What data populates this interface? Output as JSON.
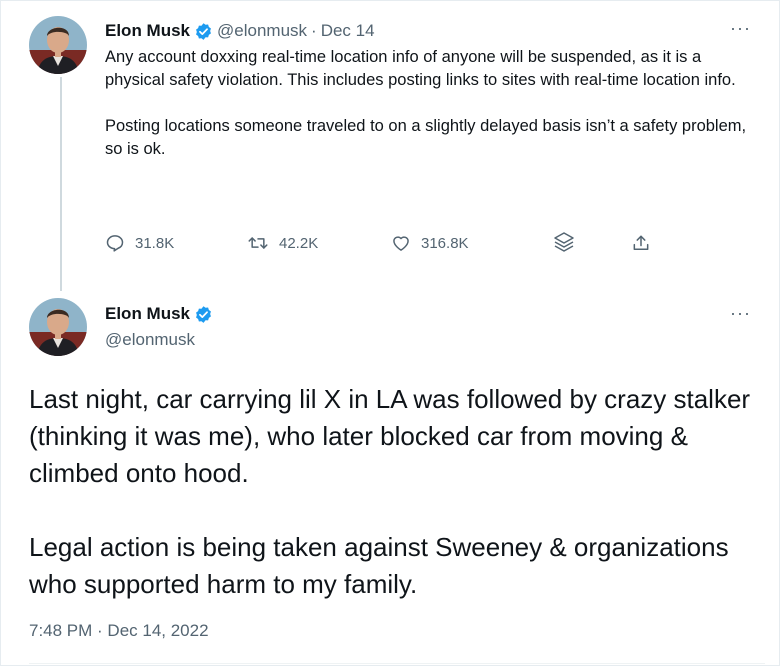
{
  "colors": {
    "text": "#0f1419",
    "secondary": "#536471",
    "verified": "#1d9bf0",
    "thread_line": "#cfd9de"
  },
  "parent_tweet": {
    "author_name": "Elon Musk",
    "author_handle": "@elonmusk",
    "separator": "·",
    "date": "Dec 14",
    "more_label": "···",
    "paragraphs": [
      "Any account doxxing real-time location info of anyone will be suspended, as it is a physical safety violation. This includes posting links to sites with real-time location info.",
      "Posting locations someone traveled to on a slightly delayed basis isn’t a safety problem, so is ok."
    ],
    "actions": {
      "replies": "31.8K",
      "retweets": "42.2K",
      "likes": "316.8K"
    },
    "icons": [
      "reply-icon",
      "retweet-icon",
      "like-icon",
      "layers-icon",
      "share-icon"
    ]
  },
  "main_tweet": {
    "author_name": "Elon Musk",
    "author_handle": "@elonmusk",
    "more_label": "···",
    "paragraphs": [
      "Last night, car carrying lil X in LA was followed by crazy stalker (thinking it was me), who later blocked car from moving & climbed onto hood.",
      "Legal action is being taken against Sweeney & organizations who supported harm to my family."
    ],
    "timestamp": "7:48 PM · Dec 14, 2022"
  }
}
